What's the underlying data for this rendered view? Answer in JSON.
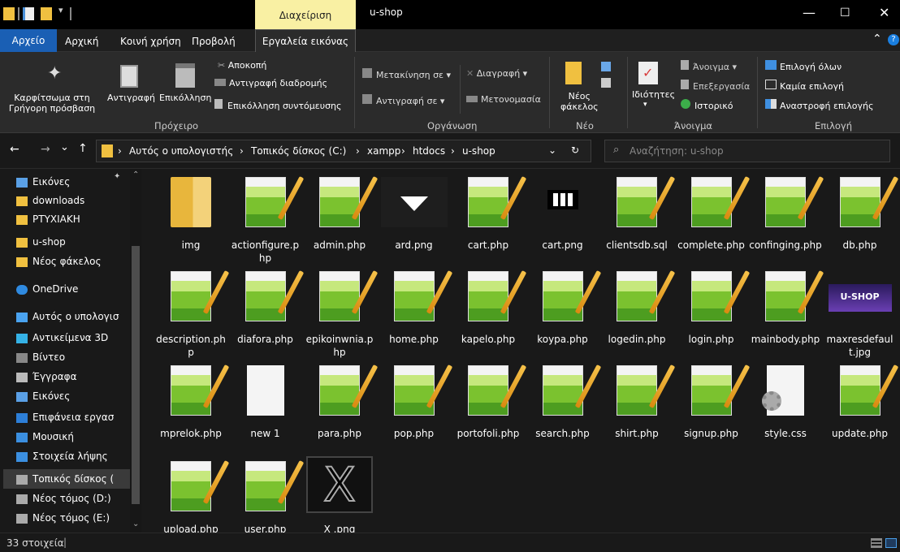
{
  "titlebar": {
    "contextual_tab": "Διαχείριση",
    "window_title": "u-shop",
    "min_glyph": "—",
    "max_glyph": "☐",
    "close_glyph": "✕"
  },
  "ribbon_tabs": {
    "file": "Αρχείο",
    "home": "Αρχική",
    "share": "Κοινή χρήση",
    "view": "Προβολή",
    "picture_tools": "Εργαλεία εικόνας",
    "collapse_glyph": "⌃",
    "help_glyph": "?"
  },
  "ribbon": {
    "clipboard": {
      "pin_1": "Καρφίτσωμα στη",
      "pin_2": "Γρήγορη πρόσβαση",
      "copy": "Αντιγραφή",
      "paste": "Επικόλληση",
      "cut": "Αποκοπή",
      "copy_path": "Αντιγραφή διαδρομής",
      "paste_shortcut": "Επικόλληση συντόμευσης",
      "label": "Πρόχειρο"
    },
    "organize": {
      "move_to": "Μετακίνηση σε ▾",
      "delete": "Διαγραφή ▾",
      "copy_to": "Αντιγραφή σε ▾",
      "rename": "Μετονομασία",
      "label": "Οργάνωση"
    },
    "new": {
      "folder_1": "Νέος",
      "folder_2": "φάκελος",
      "label": "Νέο"
    },
    "open": {
      "properties": "Ιδιότητες",
      "properties_arrow": "▾",
      "open": "Άνοιγμα ▾",
      "edit": "Επεξεργασία",
      "history": "Ιστορικό",
      "label": "Άνοιγμα"
    },
    "select": {
      "select_all": "Επιλογή όλων",
      "select_none": "Καμία επιλογή",
      "invert": "Αναστροφή επιλογής",
      "label": "Επιλογή"
    }
  },
  "nav": {
    "back": "←",
    "forward": "→",
    "recent": "⌄",
    "up": "↑",
    "breadcrumbs": [
      "Αυτός ο υπολογιστής",
      "Τοπικός δίσκος (C:)",
      "xampp",
      "htdocs",
      "u-shop"
    ],
    "separator": "›",
    "dropdown": "⌄",
    "refresh": "↻",
    "search_icon": "⌕",
    "search_placeholder": "Αναζήτηση: u-shop"
  },
  "sidebar": {
    "items": [
      {
        "label": "Εικόνες",
        "icon": "pictures-icon",
        "color": "#5aa0e6"
      },
      {
        "label": "downloads",
        "icon": "folder-icon",
        "color": "#f0c040"
      },
      {
        "label": "PTYXIAKH",
        "icon": "folder-icon",
        "color": "#f0c040"
      },
      {
        "label": "u-shop",
        "icon": "folder-icon",
        "color": "#f0c040"
      },
      {
        "label": "Νέος φάκελος",
        "icon": "folder-icon",
        "color": "#f0c040"
      },
      {
        "label": "OneDrive",
        "icon": "cloud-icon",
        "color": "#2f8ae0"
      },
      {
        "label": "Αυτός ο υπολογισ",
        "icon": "pc-icon",
        "color": "#4aa3f0"
      },
      {
        "label": "Αντικείμενα 3D",
        "icon": "cube-icon",
        "color": "#35b2e6"
      },
      {
        "label": "Βίντεο",
        "icon": "video-icon",
        "color": "#888"
      },
      {
        "label": "Έγγραφα",
        "icon": "document-icon",
        "color": "#bbb"
      },
      {
        "label": "Εικόνες",
        "icon": "pictures-icon",
        "color": "#5aa0e6"
      },
      {
        "label": "Επιφάνεια εργασ",
        "icon": "desktop-icon",
        "color": "#2d7fd8"
      },
      {
        "label": "Μουσική",
        "icon": "music-icon",
        "color": "#3b8fe0"
      },
      {
        "label": "Στοιχεία λήψης",
        "icon": "download-icon",
        "color": "#3b8fe0"
      },
      {
        "label": "Τοπικός δίσκος (",
        "icon": "drive-icon",
        "color": "#aaa"
      },
      {
        "label": "Νέος τόμος (D:)",
        "icon": "drive-icon",
        "color": "#aaa"
      },
      {
        "label": "Νέος τόμος (E:)",
        "icon": "drive-icon",
        "color": "#aaa"
      }
    ],
    "pin_glyph": "📌"
  },
  "files": [
    {
      "name": "img",
      "type": "folder"
    },
    {
      "name": "actionfigure.php",
      "type": "npp"
    },
    {
      "name": "admin.php",
      "type": "npp"
    },
    {
      "name": "ard.png",
      "type": "arrow"
    },
    {
      "name": "cart.php",
      "type": "npp"
    },
    {
      "name": "cart.png",
      "type": "cart"
    },
    {
      "name": "clientsdb.sql",
      "type": "npp"
    },
    {
      "name": "complete.php",
      "type": "npp"
    },
    {
      "name": "confinging.php",
      "type": "npp"
    },
    {
      "name": "db.php",
      "type": "npp"
    },
    {
      "name": "description.php",
      "type": "npp"
    },
    {
      "name": "diafora.php",
      "type": "npp"
    },
    {
      "name": "epikoinwnia.php",
      "type": "npp"
    },
    {
      "name": "home.php",
      "type": "npp"
    },
    {
      "name": "kapelo.php",
      "type": "npp"
    },
    {
      "name": "koypa.php",
      "type": "npp"
    },
    {
      "name": "logedin.php",
      "type": "npp"
    },
    {
      "name": "login.php",
      "type": "npp"
    },
    {
      "name": "mainbody.php",
      "type": "npp"
    },
    {
      "name": "maxresdefault.jpg",
      "type": "jpg"
    },
    {
      "name": "mprelok.php",
      "type": "npp"
    },
    {
      "name": "new 1",
      "type": "blank"
    },
    {
      "name": "para.php",
      "type": "npp"
    },
    {
      "name": "pop.php",
      "type": "npp"
    },
    {
      "name": "portofoli.php",
      "type": "npp"
    },
    {
      "name": "search.php",
      "type": "npp"
    },
    {
      "name": "shirt.php",
      "type": "npp"
    },
    {
      "name": "signup.php",
      "type": "npp"
    },
    {
      "name": "style.css",
      "type": "css"
    },
    {
      "name": "update.php",
      "type": "npp"
    },
    {
      "name": "upload.php",
      "type": "npp"
    },
    {
      "name": "user.php",
      "type": "npp"
    },
    {
      "name": "X .png",
      "type": "xpng"
    }
  ],
  "jpg_thumb_text": "U-SHOP",
  "status": {
    "count": "33 στοιχεία",
    "divider": "|"
  },
  "colors": {
    "accent": "#1a5fb4",
    "contextual": "#f9f0a3",
    "selected": "#3a3a3a"
  }
}
